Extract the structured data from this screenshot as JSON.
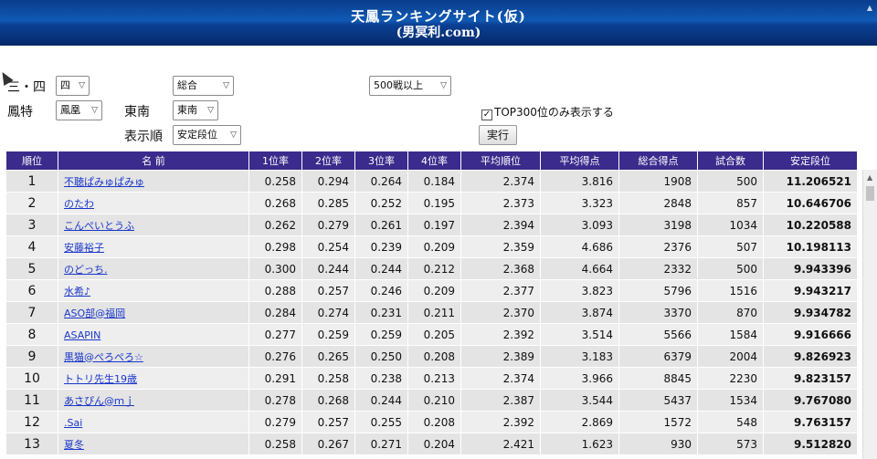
{
  "header": {
    "title": "天鳳ランキングサイト(仮)",
    "subtitle": "(男冥利.com)"
  },
  "filters": {
    "players_label": "三・四",
    "players_value": "四",
    "type_value": "総合",
    "games_value": "500戦以上",
    "rule_label": "鳳特",
    "rule_value": "鳳凰",
    "round_label": "東南",
    "round_value": "東南",
    "order_label": "表示順",
    "order_value": "安定段位",
    "top300_label": "TOP300位のみ表示する",
    "top300_checked": true,
    "run_button": "実行"
  },
  "table": {
    "columns": [
      "順位",
      "名 前",
      "1位率",
      "2位率",
      "3位率",
      "4位率",
      "平均順位",
      "平均得点",
      "総合得点",
      "試合数",
      "安定段位"
    ],
    "rows": [
      [
        "1",
        "不聴ぱみゅぱみゅ",
        "0.258",
        "0.294",
        "0.264",
        "0.184",
        "2.374",
        "3.816",
        "1908",
        "500",
        "11.206521"
      ],
      [
        "2",
        "のたわ",
        "0.268",
        "0.285",
        "0.252",
        "0.195",
        "2.373",
        "3.323",
        "2848",
        "857",
        "10.646706"
      ],
      [
        "3",
        "こんぺいとうふ",
        "0.262",
        "0.279",
        "0.261",
        "0.197",
        "2.394",
        "3.093",
        "3198",
        "1034",
        "10.220588"
      ],
      [
        "4",
        "安藤裕子",
        "0.298",
        "0.254",
        "0.239",
        "0.209",
        "2.359",
        "4.686",
        "2376",
        "507",
        "10.198113"
      ],
      [
        "5",
        "のどっち.",
        "0.300",
        "0.244",
        "0.244",
        "0.212",
        "2.368",
        "4.664",
        "2332",
        "500",
        "9.943396"
      ],
      [
        "6",
        "水希♪",
        "0.288",
        "0.257",
        "0.246",
        "0.209",
        "2.377",
        "3.823",
        "5796",
        "1516",
        "9.943217"
      ],
      [
        "7",
        "ASO部@福岡",
        "0.284",
        "0.274",
        "0.231",
        "0.211",
        "2.370",
        "3.874",
        "3370",
        "870",
        "9.934782"
      ],
      [
        "8",
        "ASAPIN",
        "0.277",
        "0.259",
        "0.259",
        "0.205",
        "2.392",
        "3.514",
        "5566",
        "1584",
        "9.916666"
      ],
      [
        "9",
        "黒猫@ぺろぺろ☆",
        "0.276",
        "0.265",
        "0.250",
        "0.208",
        "2.389",
        "3.183",
        "6379",
        "2004",
        "9.826923"
      ],
      [
        "10",
        "トトリ先生19歳",
        "0.291",
        "0.258",
        "0.238",
        "0.213",
        "2.374",
        "3.966",
        "8845",
        "2230",
        "9.823157"
      ],
      [
        "11",
        "あさぴん@ｍｊ",
        "0.278",
        "0.268",
        "0.244",
        "0.210",
        "2.387",
        "3.544",
        "5437",
        "1534",
        "9.767080"
      ],
      [
        "12",
        ".Sai",
        "0.279",
        "0.257",
        "0.255",
        "0.208",
        "2.392",
        "2.869",
        "1572",
        "548",
        "9.763157"
      ],
      [
        "13",
        "夏冬",
        "0.258",
        "0.267",
        "0.271",
        "0.204",
        "2.421",
        "1.623",
        "930",
        "573",
        "9.512820"
      ]
    ]
  }
}
